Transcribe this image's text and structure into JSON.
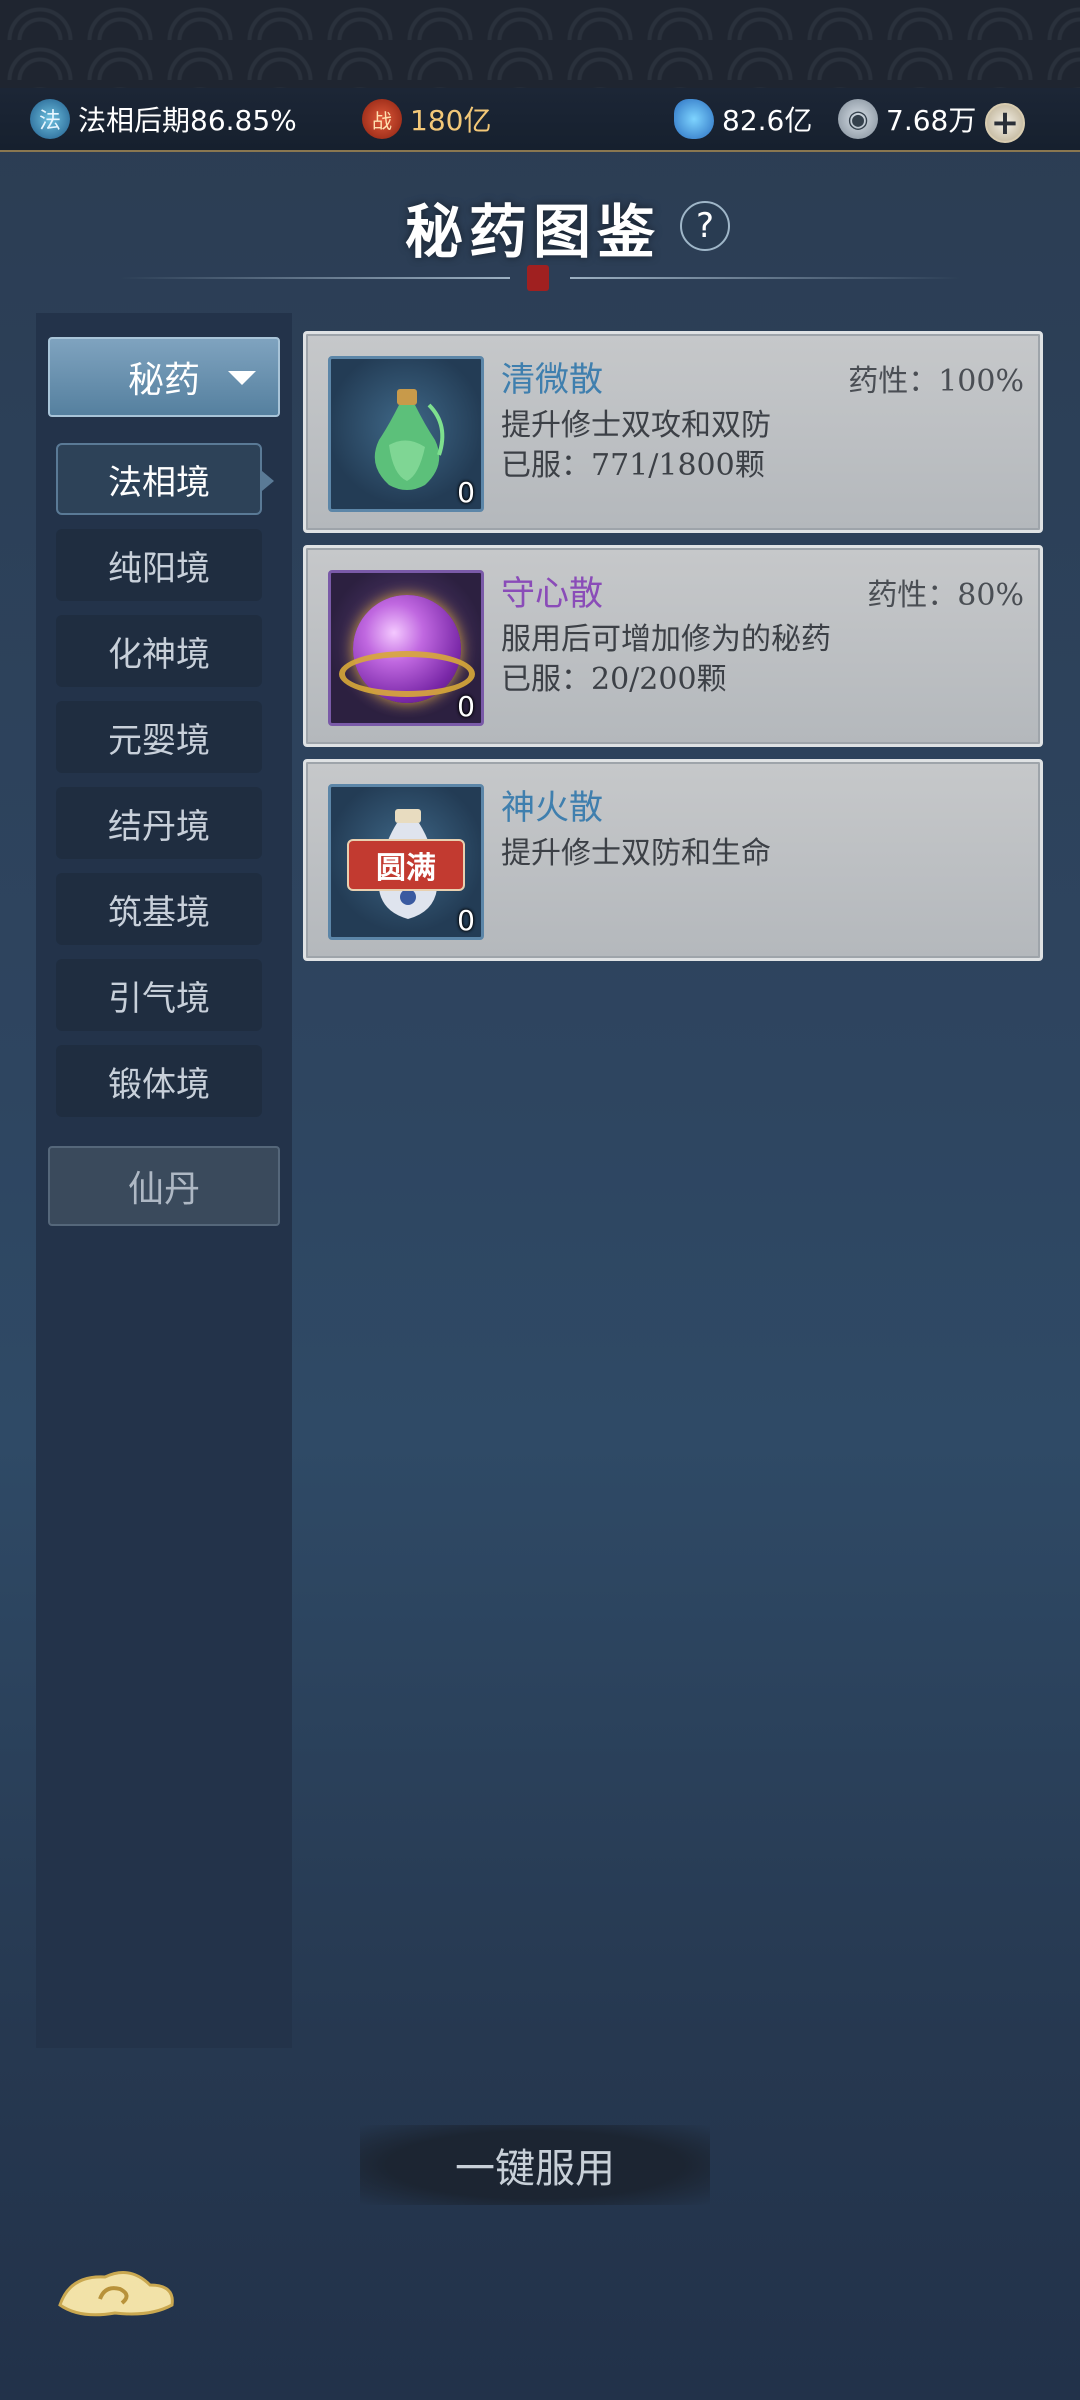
{
  "resources": {
    "realm_icon": "法",
    "realm_text": "法相后期86.85%",
    "power_icon": "战",
    "power_value": "180亿",
    "crystal_value": "82.6亿",
    "coin_value": "7.68万",
    "plus_label": "+"
  },
  "header": {
    "title": "秘药图鉴",
    "help_label": "?"
  },
  "sidebar": {
    "category_label": "秘药",
    "realms": [
      "法相境",
      "纯阳境",
      "化神境",
      "元婴境",
      "结丹境",
      "筑基境",
      "引气境",
      "锻体境"
    ],
    "active_realm": "法相境",
    "xiandan_label": "仙丹"
  },
  "cards": [
    {
      "name": "清微散",
      "name_color": "#3f7fae",
      "potency": "药性：100%",
      "desc": "提升修士双攻和双防",
      "taken": "已服：771/1800颗",
      "count": "0",
      "icon": "green-potion-icon"
    },
    {
      "name": "守心散",
      "name_color": "#8a4cb8",
      "potency": "药性：80%",
      "desc": "服用后可增加修为的秘药",
      "taken": "已服：20/200颗",
      "count": "0",
      "icon": "purple-orb-icon"
    },
    {
      "name": "神火散",
      "name_color": "#3f7fae",
      "potency": "",
      "desc": "提升修士双防和生命",
      "taken": "",
      "count": "0",
      "badge": "圆满",
      "icon": "vase-icon"
    }
  ],
  "footer": {
    "oneclick_label": "一键服用"
  }
}
